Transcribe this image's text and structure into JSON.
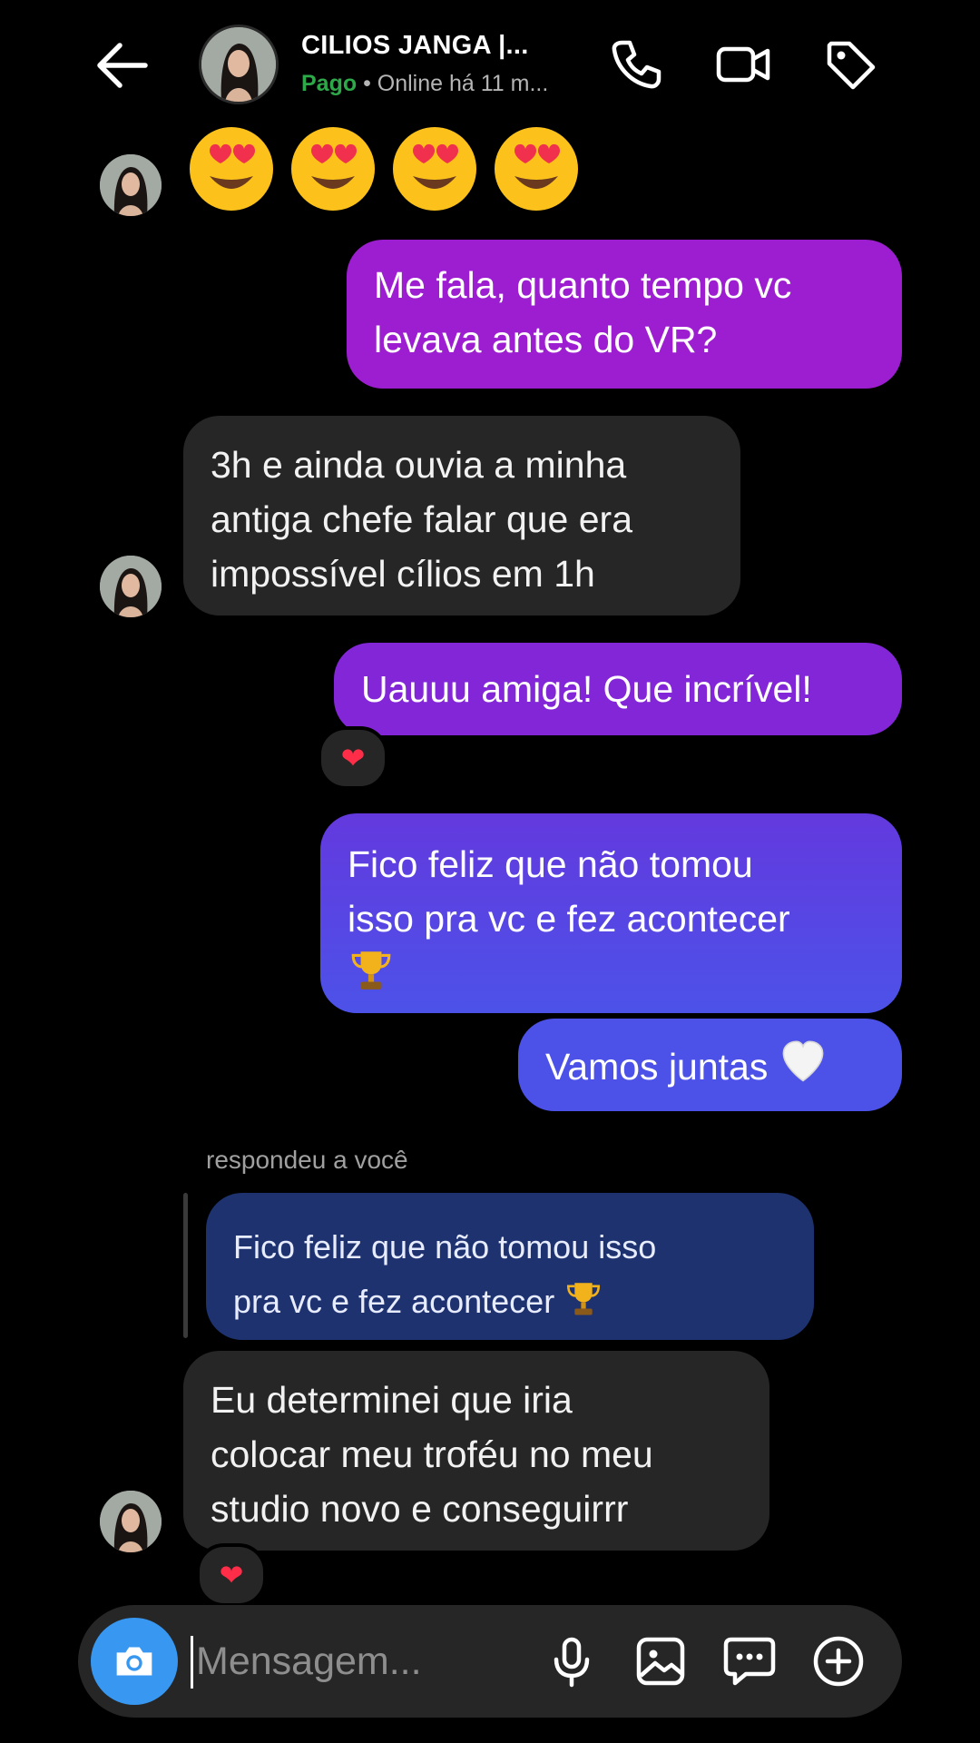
{
  "header": {
    "title": "CILIOS JANGA |...",
    "status_paid": "Pago",
    "status_rest": " • Online há 11 m...",
    "icons": [
      "back-arrow-icon",
      "phone-icon",
      "video-call-icon",
      "tag-icon"
    ]
  },
  "messages": {
    "emoji_row": [
      "heart-eyes-emoji",
      "heart-eyes-emoji",
      "heart-eyes-emoji",
      "heart-eyes-emoji"
    ],
    "m1": {
      "line1": "Me fala, quanto tempo vc",
      "line2": "levava antes do VR?"
    },
    "m2": {
      "line1": "3h e ainda ouvia a minha",
      "line2": "antiga chefe falar que era",
      "line3": "impossível cílios em 1h"
    },
    "m3": {
      "text": "Uauuu amiga! Que incrível!",
      "reaction": "❤"
    },
    "m4": {
      "line1": "Fico feliz que não tomou",
      "line2": "isso pra vc e fez acontecer",
      "emoji": "trophy"
    },
    "m5": {
      "text": "Vamos juntas",
      "emoji": "white-heart"
    },
    "reply": {
      "label": "respondeu a você",
      "quote_line1": "Fico feliz que não tomou isso",
      "quote_line2": "pra vc e fez acontecer"
    },
    "m6": {
      "line1": "Eu determinei que iria",
      "line2": "colocar meu troféu no meu",
      "line3": "studio novo e conseguirrr",
      "reaction": "❤"
    }
  },
  "composer": {
    "placeholder": "Mensagem...",
    "icons": [
      "camera-icon",
      "microphone-icon",
      "gallery-icon",
      "sticker-icon",
      "add-icon"
    ]
  },
  "colors": {
    "background": "#000000",
    "incoming_bubble": "#262626",
    "outgoing_gradient": [
      "#9c1ed0",
      "#8326d8",
      "#5b3fe0",
      "#4c52e8"
    ],
    "reply_quote_bg": "#1e3270",
    "paid_green": "#2ea94a",
    "camera_blue": "#3897f0",
    "reaction_red": "#ff2d48"
  }
}
